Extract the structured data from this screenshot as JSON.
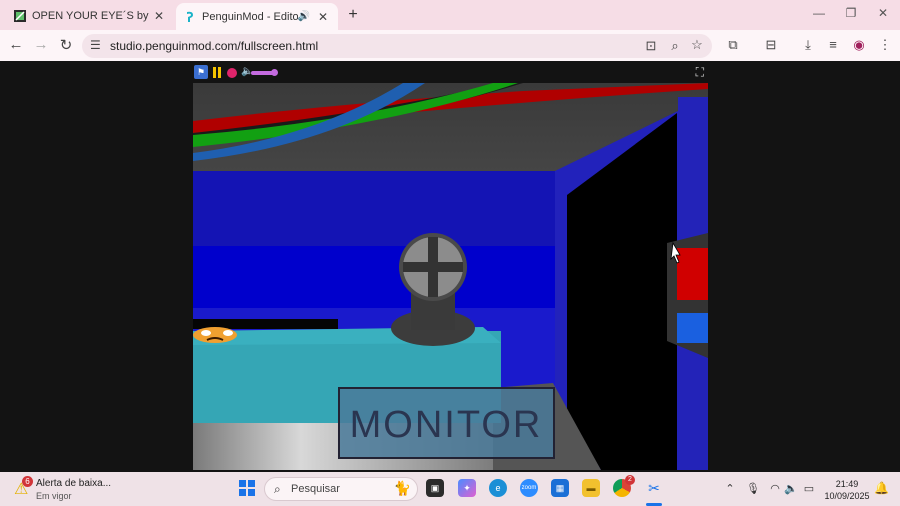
{
  "browser": {
    "tabs": [
      {
        "title": "OPEN YOUR EYE´S by Imperial-",
        "favicon": "film-icon",
        "close": "✕"
      },
      {
        "title": "PenguinMod - Editor",
        "favicon": "penguinmod-icon",
        "audio": "🔊",
        "close": "✕"
      }
    ],
    "new_tab": "+",
    "window_controls": {
      "minimize": "—",
      "restore": "❐",
      "close": "✕"
    },
    "url": "studio.penguinmod.com/fullscreen.html",
    "nav": {
      "back": "←",
      "forward": "→",
      "reload": "↻"
    }
  },
  "stage": {
    "flag": "⚑",
    "volume_icon": "🔈",
    "volume_level": 0.7,
    "fullscreen_icon": "⛶",
    "monitor_label": "MONITOR"
  },
  "colors": {
    "tab_strip": "#f6dde6",
    "flag": "#3b6fd1",
    "pause": "#f5c400",
    "stop": "#e0246b",
    "volume": "#c46be0"
  },
  "taskbar": {
    "notification": {
      "count": "6",
      "title": "Alerta de baixa...",
      "subtitle": "Em vigor"
    },
    "search_placeholder": "Pesquisar",
    "apps": [
      "task-view",
      "copilot",
      "edge",
      "zoom",
      "store",
      "file-explorer",
      "chrome",
      "snipping-tool"
    ],
    "zoom_label": "zoom",
    "chrome_badge": "2",
    "time": "21:49",
    "date": "10/09/2025"
  }
}
